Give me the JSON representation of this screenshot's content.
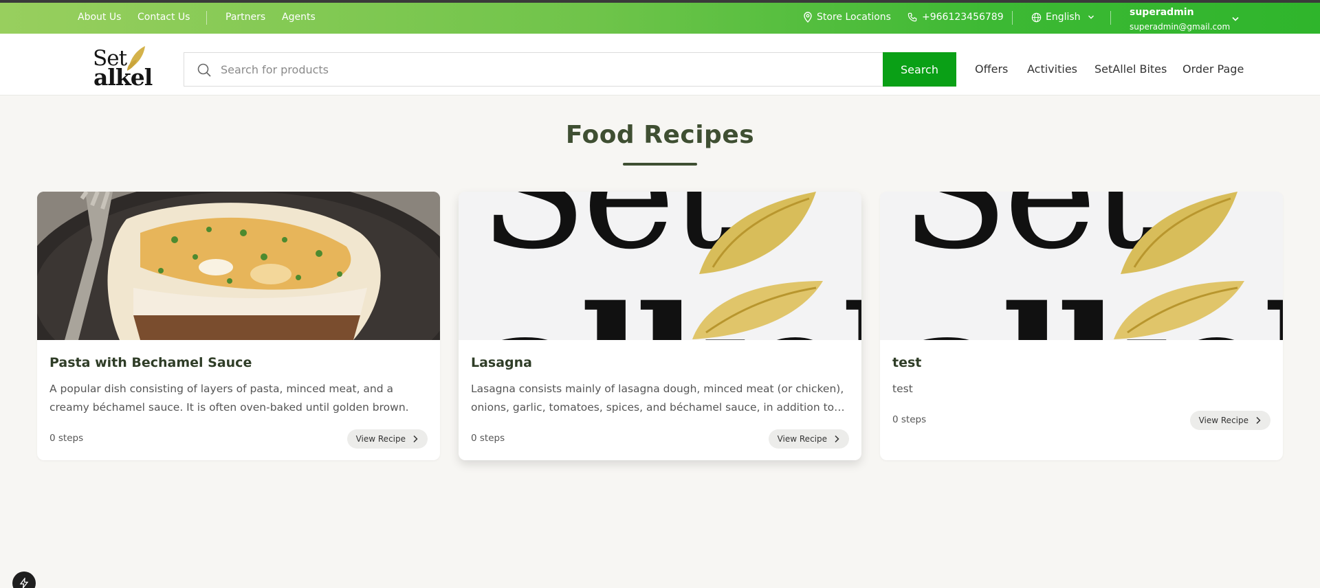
{
  "topbar": {
    "links": [
      "About Us",
      "Contact Us",
      "Partners",
      "Agents"
    ],
    "store_locations": "Store Locations",
    "phone": "+966123456789",
    "language": "English",
    "user_name": "superadmin",
    "user_email": "superadmin@gmail.com"
  },
  "header": {
    "logo_top": "Set",
    "logo_bottom": "alkel",
    "search_placeholder": "Search for products",
    "search_button": "Search",
    "nav": [
      "Offers",
      "Activities",
      "SetAllel Bites",
      "Order Page"
    ]
  },
  "main": {
    "title": "Food Recipes",
    "recipes": [
      {
        "title": "Pasta with Bechamel Sauce",
        "description": "A popular dish consisting of layers of pasta, minced meat, and a creamy béchamel sauce. It is often oven-baked until golden brown.",
        "steps": "0 steps",
        "button": "View Recipe",
        "image": "pasta-photo"
      },
      {
        "title": "Lasagna",
        "description": "Lasagna consists mainly of lasagna dough, minced meat (or chicken), onions, garlic, tomatoes, spices, and béchamel sauce, in addition to…",
        "steps": "0 steps",
        "button": "View Recipe",
        "image": "setalkel-logo"
      },
      {
        "title": "test",
        "description": "test",
        "steps": "0 steps",
        "button": "View Recipe",
        "image": "setalkel-logo"
      }
    ]
  },
  "colors": {
    "brand_green": "#0aa016",
    "title_dark_green": "#3f4f32",
    "logo_gold": "#d4b24a"
  }
}
